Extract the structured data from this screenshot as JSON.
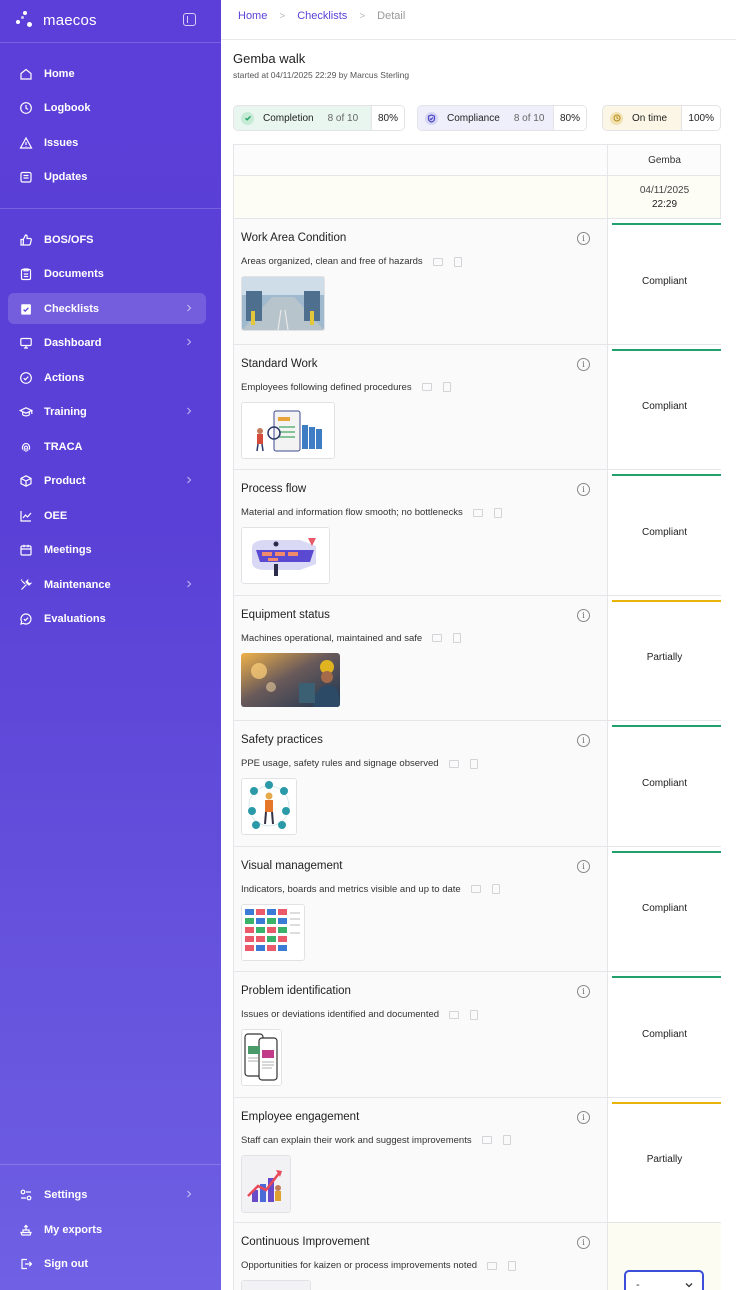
{
  "brand": {
    "name": "maecos"
  },
  "nav": {
    "top": [
      {
        "label": "Home",
        "icon": "home-icon"
      },
      {
        "label": "Logbook",
        "icon": "clock-icon"
      },
      {
        "label": "Issues",
        "icon": "warning-icon"
      },
      {
        "label": "Updates",
        "icon": "updates-icon"
      }
    ],
    "main": [
      {
        "label": "BOS/OFS",
        "icon": "thumbs-up-icon"
      },
      {
        "label": "Documents",
        "icon": "clipboard-icon"
      },
      {
        "label": "Checklists",
        "icon": "checklist-icon",
        "active": true,
        "chevron": true
      },
      {
        "label": "Dashboard",
        "icon": "monitor-icon",
        "chevron": true
      },
      {
        "label": "Actions",
        "icon": "check-circle-icon"
      },
      {
        "label": "Training",
        "icon": "graduation-cap-icon",
        "chevron": true
      },
      {
        "label": "TRACA",
        "icon": "fingerprint-icon"
      },
      {
        "label": "Product",
        "icon": "box-icon",
        "chevron": true
      },
      {
        "label": "OEE",
        "icon": "line-chart-icon"
      },
      {
        "label": "Meetings",
        "icon": "calendar-icon"
      },
      {
        "label": "Maintenance",
        "icon": "tools-icon",
        "chevron": true
      },
      {
        "label": "Evaluations",
        "icon": "chat-check-icon"
      }
    ],
    "bottom": [
      {
        "label": "Settings",
        "icon": "settings-icon",
        "chevron": true
      },
      {
        "label": "My exports",
        "icon": "exports-icon"
      },
      {
        "label": "Sign out",
        "icon": "sign-out-icon"
      }
    ]
  },
  "breadcrumb": {
    "home": "Home",
    "checklists": "Checklists",
    "current": "Detail"
  },
  "page": {
    "title": "Gemba walk",
    "subtitle": "started at 04/11/2025 22:29 by Marcus Sterling"
  },
  "stats": {
    "completion": {
      "label": "Completion",
      "count": "8 of 10",
      "pct": "80%"
    },
    "compliance": {
      "label": "Compliance",
      "count": "8 of 10",
      "pct": "80%"
    },
    "ontime": {
      "label": "On time",
      "pct": "100%"
    }
  },
  "table": {
    "column": "Gemba",
    "date": "04/11/2025",
    "time": "22:29",
    "rows": [
      {
        "title": "Work Area Condition",
        "desc": "Areas organized, clean and free of hazards",
        "status": "Compliant",
        "thumb": "warehouse-photo"
      },
      {
        "title": "Standard Work",
        "desc": "Employees following defined procedures",
        "status": "Compliant",
        "thumb": "sop-illustration"
      },
      {
        "title": "Process flow",
        "desc": "Material and information flow smooth; no bottlenecks",
        "status": "Compliant",
        "thumb": "process-flow-illustration"
      },
      {
        "title": "Equipment status",
        "desc": "Machines operational, maintained and safe",
        "status": "Partially",
        "thumb": "worker-photo"
      },
      {
        "title": "Safety practices",
        "desc": "PPE usage, safety rules and signage observed",
        "status": "Compliant",
        "thumb": "ppe-illustration"
      },
      {
        "title": "Visual management",
        "desc": "Indicators, boards and metrics visible and up to date",
        "status": "Compliant",
        "thumb": "board-illustration"
      },
      {
        "title": "Problem identification",
        "desc": "Issues or deviations identified and documented",
        "status": "Compliant",
        "thumb": "phone-illustration"
      },
      {
        "title": "Employee engagement",
        "desc": "Staff can explain their work and suggest improvements",
        "status": "Partially",
        "thumb": "growth-illustration"
      },
      {
        "title": "Continuous Improvement",
        "desc": "Opportunities for kaizen or process improvements noted",
        "status": "",
        "thumb": "improvement-illustration",
        "select": "-"
      }
    ]
  },
  "colors": {
    "accent": "#5b3fd8",
    "compliant": "#22a06b",
    "partial": "#e8b40c",
    "select_border": "#3b4fd8"
  }
}
